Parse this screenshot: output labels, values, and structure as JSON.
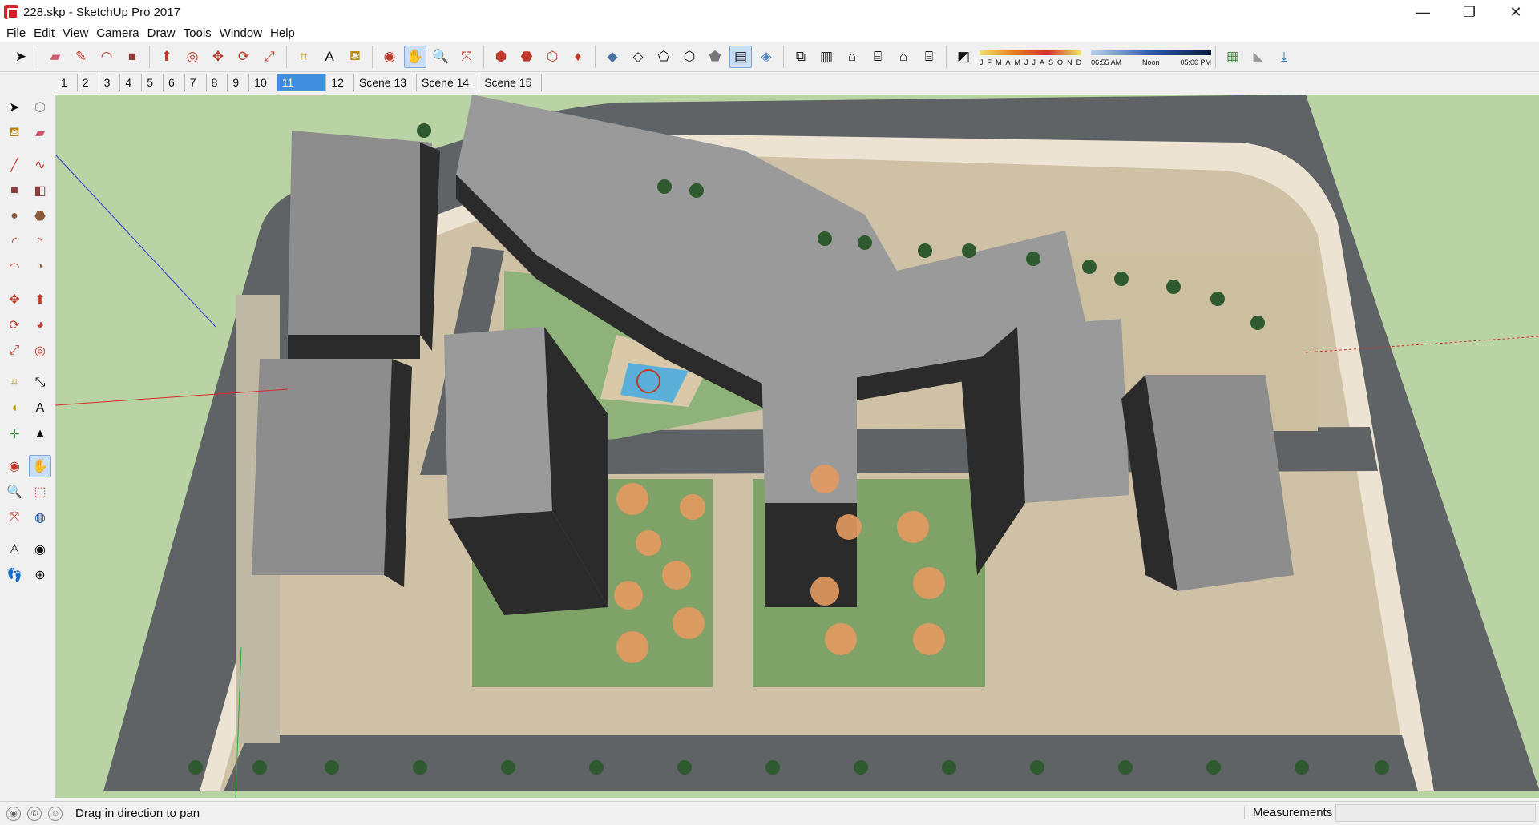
{
  "window": {
    "title": "228.skp - SketchUp Pro 2017",
    "minimize": "—",
    "restore": "❐",
    "close": "✕"
  },
  "menu": [
    "File",
    "Edit",
    "View",
    "Camera",
    "Draw",
    "Tools",
    "Window",
    "Help"
  ],
  "shadow": {
    "months": [
      "J",
      "F",
      "M",
      "A",
      "M",
      "J",
      "J",
      "A",
      "S",
      "O",
      "N",
      "D"
    ],
    "time_start": "06:55 AM",
    "time_mid": "Noon",
    "time_end": "05:00 PM"
  },
  "scenes": [
    "1",
    "2",
    "3",
    "4",
    "5",
    "6",
    "7",
    "8",
    "9",
    "10",
    "11",
    "12",
    "Scene 13",
    "Scene 14",
    "Scene 15"
  ],
  "active_scene": "11",
  "status": {
    "hint": "Drag in direction to pan",
    "measurements_label": "Measurements",
    "measurements_value": ""
  },
  "colors": {
    "accent": "#3f8fde",
    "ground": "#b9d3a5",
    "road": "#5f6366",
    "sidewalk": "#ece3d2",
    "roof": "#9a9a9a",
    "facade": "#2b2b2b",
    "paving": "#cdb79a",
    "tree_autumn": "#e59a60",
    "tree_green": "#2f5a2f",
    "pool": "#5ab0d8"
  }
}
